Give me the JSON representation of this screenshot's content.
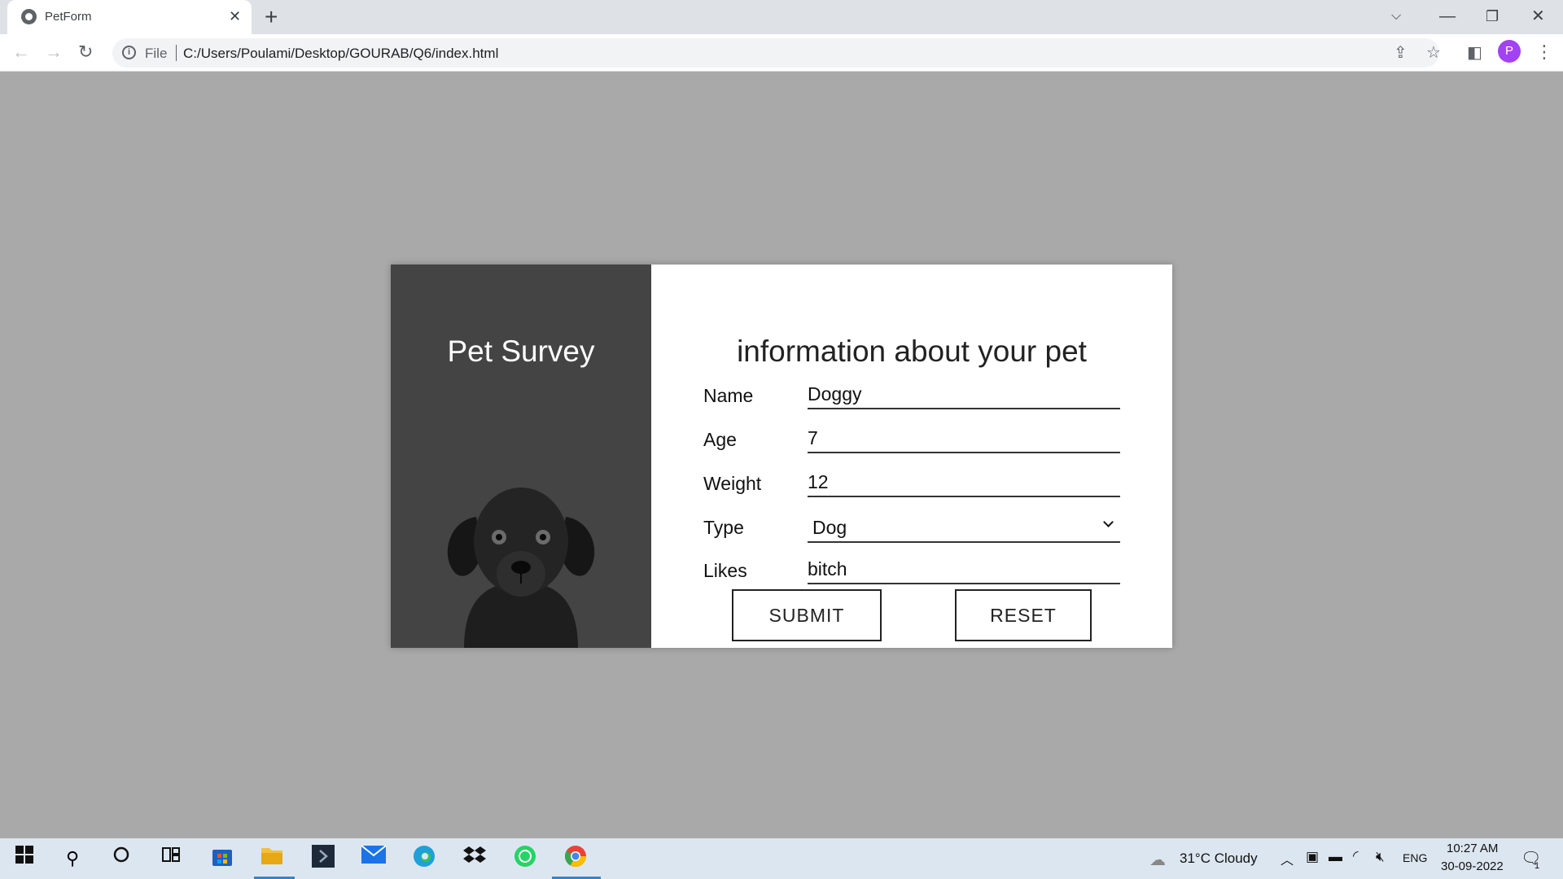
{
  "browser": {
    "tab_title": "PetForm",
    "scheme": "File",
    "url": "C:/Users/Poulami/Desktop/GOURAB/Q6/index.html",
    "profile_initial": "P"
  },
  "page": {
    "left_title": "Pet Survey",
    "form_title": "information about your pet",
    "fields": {
      "name": {
        "label": "Name",
        "value": "Doggy"
      },
      "age": {
        "label": "Age",
        "value": "7"
      },
      "weight": {
        "label": "Weight",
        "value": "12"
      },
      "type": {
        "label": "Type",
        "value": "Dog"
      },
      "likes": {
        "label": "Likes",
        "value": "bitch"
      }
    },
    "submit_label": "SUBMIT",
    "reset_label": "RESET"
  },
  "taskbar": {
    "weather": "31°C  Cloudy",
    "language": "ENG",
    "time": "10:27 AM",
    "date": "30-09-2022",
    "notification_count": "1"
  },
  "colors": {
    "page_bg": "#a9a9a9",
    "left_panel": "#444444",
    "profile": "#a142f4"
  }
}
